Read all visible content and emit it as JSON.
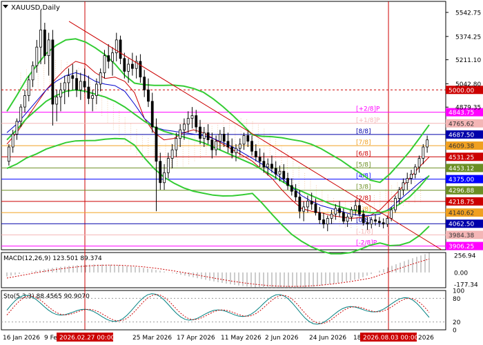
{
  "chart_data": [
    {
      "type": "candlestick",
      "panel": "main",
      "title": "XAUUSD,Daily",
      "ylim": [
        3880,
        5620
      ],
      "price_axis_ticks": [
        5542.75,
        5374.25,
        5211.1,
        5042.8,
        4879.35
      ],
      "x_ticks": [
        "16 Jan 2026",
        "9 Feb 2026",
        "25 Mar 2026",
        "17 Apr 2026",
        "11 May 2026",
        "2 Jun 2026",
        "24 Jun 2026",
        "18",
        "2026"
      ],
      "x_tick_highlight": [
        "2026.02.27 00:00",
        "2026.08.03 00:00"
      ],
      "murrey_levels": [
        {
          "price": 4843.75,
          "label": "[+2/8]P",
          "color": "#ff00ff"
        },
        {
          "price": 4765.62,
          "label": "[+1/8]P",
          "color": "#f4b6b6"
        },
        {
          "price": 4687.5,
          "label": "[8/8]",
          "color": "#0000aa"
        },
        {
          "price": 4609.38,
          "label": "[7/8]",
          "color": "#f0a020"
        },
        {
          "price": 4531.25,
          "label": "[6/8]",
          "color": "#cc0000"
        },
        {
          "price": 4453.12,
          "label": "[5/8]",
          "color": "#6b8e23"
        },
        {
          "price": 4375.0,
          "label": "[4/8]",
          "color": "#0000ff"
        },
        {
          "price": 4296.88,
          "label": "[3/8]",
          "color": "#6b8e23"
        },
        {
          "price": 4218.75,
          "label": "[2/8]",
          "color": "#cc0000"
        },
        {
          "price": 4140.62,
          "label": "[1/8]",
          "color": "#f0a020"
        },
        {
          "price": 4062.5,
          "label": "[0/8]",
          "color": "#0000aa"
        },
        {
          "price": 3984.38,
          "label": "[-1/8]",
          "color": "#f4b6b6"
        },
        {
          "price": 3906.25,
          "label": "[-2/8]P",
          "color": "#ff00ff"
        }
      ],
      "extra_levels": [
        {
          "price": 5000.0,
          "color": "#cc0000",
          "style": "dashed"
        }
      ],
      "candles_ohlc_approx": [
        [
          4500,
          4620,
          4470,
          4600
        ],
        [
          4600,
          4720,
          4560,
          4690
        ],
        [
          4690,
          4800,
          4650,
          4780
        ],
        [
          4780,
          4900,
          4740,
          4880
        ],
        [
          4880,
          5000,
          4840,
          4960
        ],
        [
          4960,
          5100,
          4920,
          5070
        ],
        [
          5070,
          5200,
          5020,
          5170
        ],
        [
          5170,
          5350,
          5120,
          5300
        ],
        [
          5300,
          5560,
          5180,
          5420
        ],
        [
          5420,
          5470,
          5180,
          5240
        ],
        [
          5240,
          5400,
          5100,
          5350
        ],
        [
          5350,
          5420,
          4750,
          4900
        ],
        [
          4900,
          5000,
          4780,
          4950
        ],
        [
          4950,
          5050,
          4850,
          5000
        ],
        [
          5000,
          5100,
          4900,
          5050
        ],
        [
          5050,
          5150,
          4950,
          5100
        ],
        [
          5100,
          5180,
          5000,
          5080
        ],
        [
          5080,
          5140,
          4950,
          5000
        ],
        [
          5000,
          5120,
          4930,
          5060
        ],
        [
          5060,
          5150,
          4980,
          5020
        ],
        [
          5020,
          5100,
          4900,
          4940
        ],
        [
          4940,
          5000,
          4850,
          4960
        ],
        [
          4960,
          5080,
          4900,
          5040
        ],
        [
          5040,
          5150,
          4990,
          5120
        ],
        [
          5120,
          5280,
          5080,
          5240
        ],
        [
          5240,
          5320,
          5150,
          5200
        ],
        [
          5200,
          5300,
          5100,
          5260
        ],
        [
          5260,
          5400,
          5200,
          5350
        ],
        [
          5350,
          5380,
          5180,
          5220
        ],
        [
          5220,
          5260,
          5080,
          5130
        ],
        [
          5130,
          5220,
          5050,
          5180
        ],
        [
          5180,
          5260,
          5100,
          5150
        ],
        [
          5150,
          5240,
          5080,
          5200
        ],
        [
          5200,
          5250,
          5050,
          5090
        ],
        [
          5090,
          5140,
          4950,
          5000
        ],
        [
          5000,
          5080,
          4880,
          4920
        ],
        [
          4920,
          4980,
          4700,
          4740
        ],
        [
          4740,
          4800,
          4150,
          4500
        ],
        [
          4500,
          4560,
          4300,
          4350
        ],
        [
          4350,
          4480,
          4300,
          4420
        ],
        [
          4420,
          4560,
          4380,
          4520
        ],
        [
          4520,
          4620,
          4450,
          4580
        ],
        [
          4580,
          4700,
          4530,
          4660
        ],
        [
          4660,
          4760,
          4600,
          4720
        ],
        [
          4720,
          4800,
          4650,
          4760
        ],
        [
          4760,
          4850,
          4700,
          4800
        ],
        [
          4800,
          4880,
          4730,
          4820
        ],
        [
          4820,
          4860,
          4700,
          4740
        ],
        [
          4740,
          4790,
          4620,
          4660
        ],
        [
          4660,
          4740,
          4600,
          4700
        ],
        [
          4700,
          4760,
          4620,
          4650
        ],
        [
          4650,
          4700,
          4520,
          4580
        ],
        [
          4580,
          4680,
          4540,
          4640
        ],
        [
          4640,
          4720,
          4580,
          4690
        ],
        [
          4690,
          4740,
          4600,
          4640
        ],
        [
          4640,
          4700,
          4560,
          4600
        ],
        [
          4600,
          4660,
          4520,
          4560
        ],
        [
          4560,
          4620,
          4500,
          4590
        ],
        [
          4590,
          4660,
          4540,
          4620
        ],
        [
          4620,
          4700,
          4580,
          4680
        ],
        [
          4680,
          4720,
          4600,
          4640
        ],
        [
          4640,
          4680,
          4540,
          4570
        ],
        [
          4570,
          4620,
          4500,
          4530
        ],
        [
          4530,
          4590,
          4460,
          4500
        ],
        [
          4500,
          4560,
          4420,
          4460
        ],
        [
          4460,
          4520,
          4400,
          4480
        ],
        [
          4480,
          4540,
          4420,
          4450
        ],
        [
          4450,
          4500,
          4380,
          4410
        ],
        [
          4410,
          4470,
          4360,
          4430
        ],
        [
          4430,
          4480,
          4350,
          4380
        ],
        [
          4380,
          4420,
          4300,
          4330
        ],
        [
          4330,
          4380,
          4260,
          4290
        ],
        [
          4290,
          4340,
          4220,
          4250
        ],
        [
          4250,
          4300,
          4100,
          4150
        ],
        [
          4150,
          4220,
          4080,
          4180
        ],
        [
          4180,
          4260,
          4140,
          4220
        ],
        [
          4220,
          4280,
          4160,
          4200
        ],
        [
          4200,
          4240,
          4120,
          4140
        ],
        [
          4140,
          4180,
          4060,
          4090
        ],
        [
          4090,
          4140,
          4030,
          4060
        ],
        [
          4060,
          4120,
          4010,
          4100
        ],
        [
          4100,
          4160,
          4060,
          4130
        ],
        [
          4130,
          4200,
          4090,
          4170
        ],
        [
          4170,
          4220,
          4110,
          4140
        ],
        [
          4140,
          4170,
          4060,
          4080
        ],
        [
          4080,
          4130,
          4040,
          4110
        ],
        [
          4110,
          4180,
          4080,
          4160
        ],
        [
          4160,
          4230,
          4120,
          4190
        ],
        [
          4190,
          4230,
          4110,
          4130
        ],
        [
          4130,
          4160,
          4050,
          4070
        ],
        [
          4070,
          4110,
          4020,
          4060
        ],
        [
          4060,
          4110,
          4030,
          4090
        ],
        [
          4090,
          4130,
          4050,
          4080
        ],
        [
          4080,
          4110,
          4040,
          4070
        ],
        [
          4070,
          4100,
          4030,
          4060
        ],
        [
          4060,
          4120,
          4040,
          4100
        ],
        [
          4100,
          4180,
          4080,
          4160
        ],
        [
          4160,
          4260,
          4140,
          4240
        ],
        [
          4240,
          4320,
          4200,
          4300
        ],
        [
          4300,
          4380,
          4260,
          4350
        ],
        [
          4350,
          4420,
          4300,
          4380
        ],
        [
          4380,
          4440,
          4340,
          4410
        ],
        [
          4410,
          4480,
          4380,
          4460
        ],
        [
          4460,
          4540,
          4420,
          4520
        ],
        [
          4520,
          4620,
          4480,
          4600
        ],
        [
          4600,
          4680,
          4560,
          4650
        ]
      ],
      "moving_averages_approx": {
        "red_fast": [
          4620,
          4700,
          4800,
          4900,
          5000,
          5080,
          5150,
          5200,
          5180,
          5120,
          5080,
          5090,
          5060,
          4980,
          4800,
          4700,
          4650,
          4660,
          4700,
          4720,
          4700,
          4660,
          4620,
          4580,
          4540,
          4500,
          4440,
          4380,
          4300,
          4230,
          4170,
          4150,
          4140,
          4120,
          4110,
          4100,
          4105,
          4120,
          4160,
          4230,
          4300,
          4380,
          4460,
          4530
        ],
        "blue_mid": [
          4700,
          4760,
          4840,
          4920,
          5000,
          5060,
          5100,
          5120,
          5100,
          5060,
          5040,
          5030,
          4990,
          4900,
          4800,
          4740,
          4720,
          4710,
          4700,
          4690,
          4680,
          4660,
          4630,
          4600,
          4560,
          4520,
          4480,
          4430,
          4380,
          4320,
          4260,
          4220,
          4190,
          4170,
          4150,
          4130,
          4120,
          4120,
          4130,
          4170,
          4230,
          4290,
          4350,
          4400
        ],
        "green_slow": [
          4650,
          4720,
          4800,
          4860,
          4920,
          4960,
          4990,
          5000,
          4990,
          4970,
          4950,
          4920,
          4880,
          4830,
          4780,
          4740,
          4710,
          4690,
          4670,
          4650,
          4630,
          4600,
          4570,
          4540,
          4510,
          4480,
          4440,
          4400,
          4360,
          4320,
          4290,
          4260,
          4230,
          4200,
          4180,
          4160,
          4150,
          4140,
          4140,
          4160,
          4200,
          4250,
          4320,
          4400
        ]
      }
    },
    {
      "type": "histogram",
      "panel": "macd",
      "title": "MACD(12,26,9) 123.501 89.374",
      "ylim": [
        -230,
        300
      ],
      "y_ticks": [
        256.94,
        0.0,
        -177.34
      ]
    },
    {
      "type": "line",
      "panel": "stochastic",
      "title": "Sto(5,3,3) 88.4565 90.9070",
      "ylim": [
        0,
        100
      ],
      "y_ticks": [
        100,
        80,
        20,
        0
      ]
    }
  ]
}
